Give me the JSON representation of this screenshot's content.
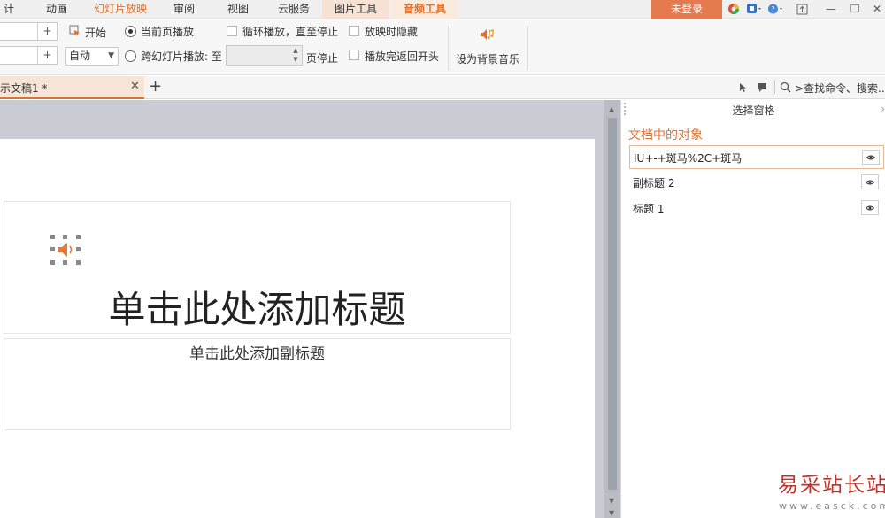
{
  "menu": {
    "tabs": [
      "计",
      "动画",
      "幻灯片放映",
      "审阅",
      "视图",
      "云服务",
      "图片工具",
      "音频工具"
    ],
    "login_label": "未登录"
  },
  "ribbon": {
    "start_label": "开始",
    "mode_select": "自动",
    "radio_current": "当前页播放",
    "radio_cross": "跨幻灯片播放: 至",
    "page_stop": "页停止",
    "loop_label": "循环播放，直至停止",
    "hide_label": "放映时隐藏",
    "rewind_label": "播放完返回开头",
    "bg_music_label": "设为背景音乐"
  },
  "tabs": {
    "doc_tab": "示文稿1 *",
    "search_command": ">查找命令、搜索..."
  },
  "slide": {
    "title_placeholder": "单击此处添加标题",
    "subtitle_placeholder": "单击此处添加副标题"
  },
  "pane": {
    "title": "选择窗格",
    "section": "文档中的对象",
    "objects": [
      "IU+-+斑马%2C+斑马",
      "副标题 2",
      "标题 1"
    ]
  },
  "watermark": {
    "text": "易采站长站",
    "url": "www.easck.com"
  },
  "colors": {
    "accent": "#e0702c",
    "login": "#e57a4e",
    "workspace": "#c9ccd3"
  }
}
